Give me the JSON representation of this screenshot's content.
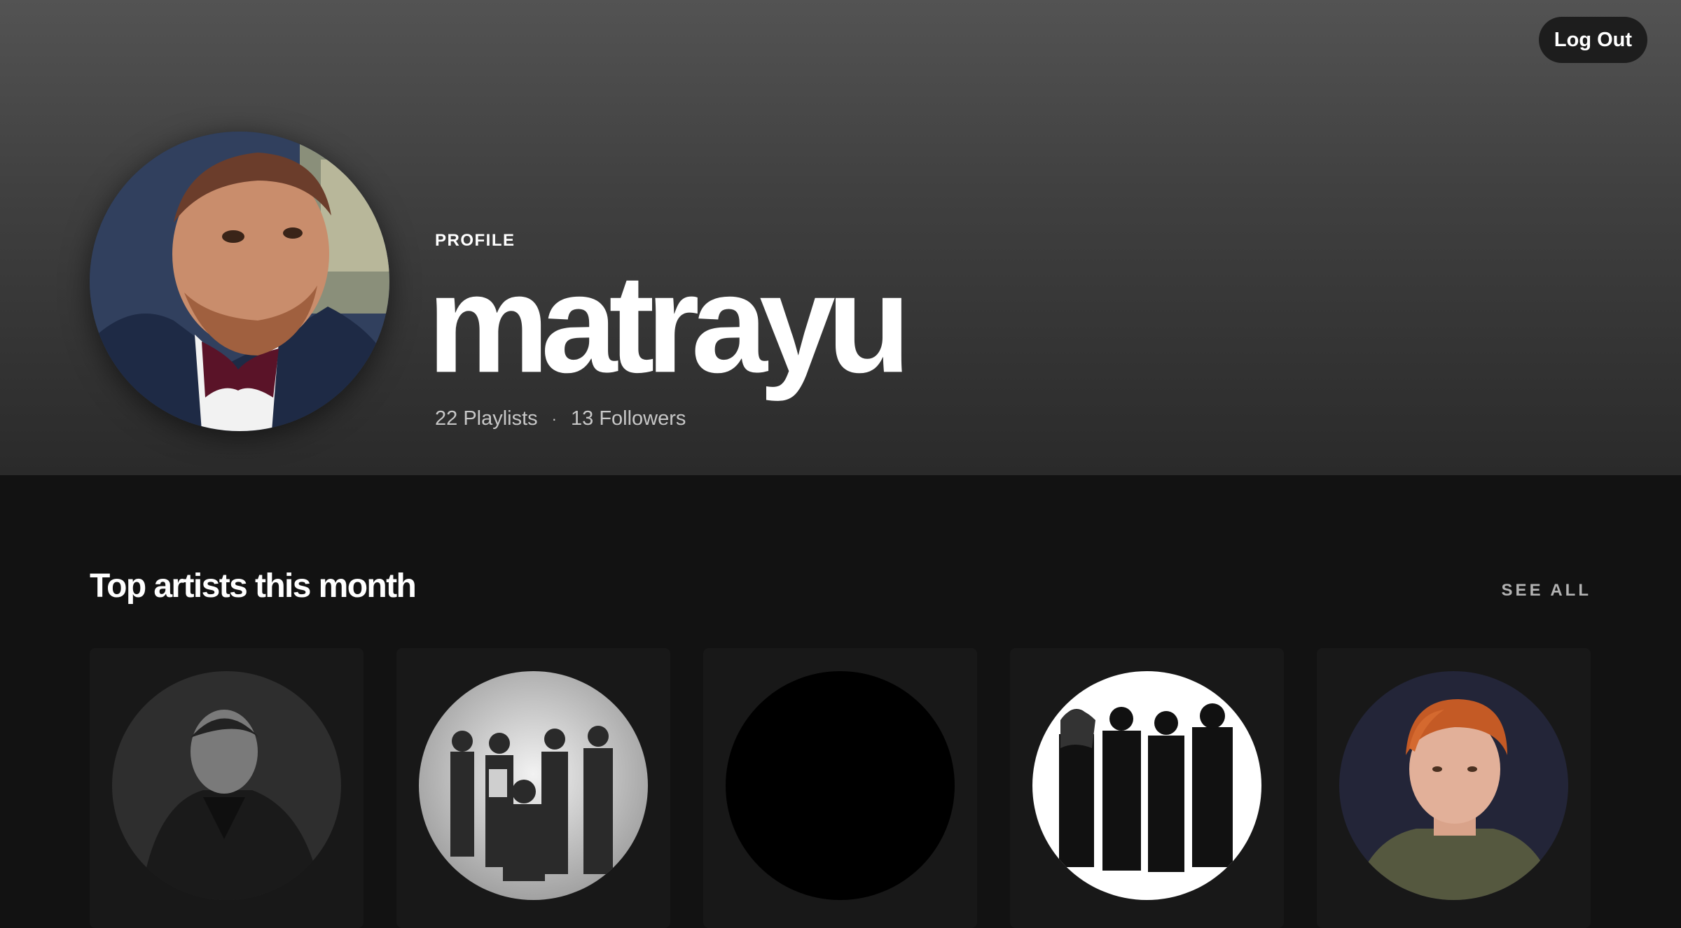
{
  "header": {
    "logout_label": "Log Out",
    "profile_label": "PROFILE",
    "username": "matrayu",
    "playlists": "22 Playlists",
    "separator": "·",
    "followers": "13 Followers"
  },
  "top_artists": {
    "title": "Top artists this month",
    "see_all": "SEE ALL",
    "artists": [
      {
        "image": "grayscale portrait of man in dark coat"
      },
      {
        "image": "grayscale group photo of five-piece band"
      },
      {
        "image": "black placeholder"
      },
      {
        "image": "black and white photo of four-piece band on white"
      },
      {
        "image": "color portrait of red-haired man in green sweater"
      }
    ]
  },
  "colors": {
    "background": "#121212",
    "card": "#181818",
    "header_top": "#535353",
    "muted_text": "#b3b3b3"
  }
}
